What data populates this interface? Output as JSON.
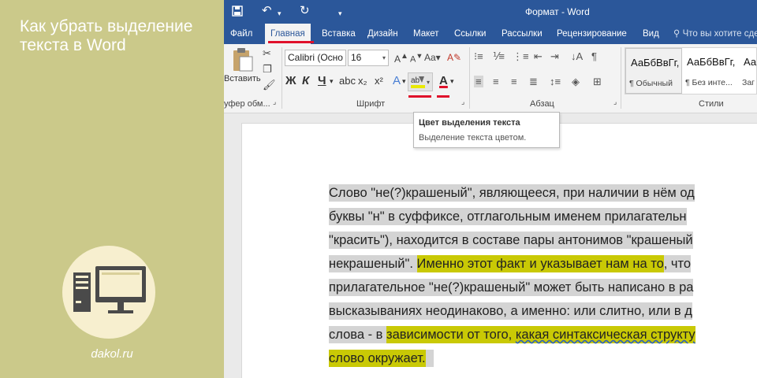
{
  "banner": {
    "title": "Как убрать выделение текста в Word",
    "site": "dakol.ru"
  },
  "titlebar": {
    "doc_title": "Формат - Word",
    "icons": [
      "save-icon",
      "undo-icon",
      "redo-icon",
      "customize-icon"
    ]
  },
  "tabs": [
    {
      "label": "Файл",
      "active": false
    },
    {
      "label": "Главная",
      "active": true
    },
    {
      "label": "Вставка",
      "active": false
    },
    {
      "label": "Дизайн",
      "active": false
    },
    {
      "label": "Макет",
      "active": false
    },
    {
      "label": "Ссылки",
      "active": false
    },
    {
      "label": "Рассылки",
      "active": false
    },
    {
      "label": "Рецензирование",
      "active": false
    },
    {
      "label": "Вид",
      "active": false
    }
  ],
  "tell_me": "Что вы хотите сде",
  "ribbon": {
    "clipboard": {
      "paste_label": "Вставить",
      "group_label": "уфер обм..."
    },
    "font": {
      "font_name": "Calibri (Осно",
      "font_size": "16",
      "bold": "Ж",
      "italic": "К",
      "underline": "Ч",
      "subscript": "x₂",
      "superscript": "x²",
      "group_label": "Шрифт"
    },
    "paragraph": {
      "group_label": "Абзац"
    },
    "styles": {
      "group_label": "Стили",
      "items": [
        {
          "sample": "АаБбВвГг,",
          "name": "¶ Обычный"
        },
        {
          "sample": "АаБбВвГг,",
          "name": "¶ Без инте..."
        },
        {
          "sample": "АаБбВ",
          "name": "Заг"
        }
      ]
    }
  },
  "tooltip": {
    "title": "Цвет выделения текста",
    "description": "Выделение текста цветом."
  },
  "document": {
    "lines": [
      [
        {
          "text": "Слово \"не(?)крашеный\", являющееся, при наличии в нём од",
          "hl": "gray"
        }
      ],
      [
        {
          "text": "буквы \"н\" в суффиксе, отглагольным именем прилагательн",
          "hl": "gray"
        }
      ],
      [
        {
          "text": "\"красить\"), находится в составе пары антонимов \"крашеный",
          "hl": "gray"
        }
      ],
      [
        {
          "text": "некрашеный\". ",
          "hl": "gray"
        },
        {
          "text": "Именно этот факт и указывает нам на то",
          "hl": "yel"
        },
        {
          "text": ", что",
          "hl": "gray"
        }
      ],
      [
        {
          "text": "прилагательное \"не(?)крашеный\" может быть написано в ра",
          "hl": "gray"
        }
      ],
      [
        {
          "text": "высказываниях неодинаково, а именно: или слитно, или в д",
          "hl": "gray"
        }
      ],
      [
        {
          "text": "слова - в ",
          "hl": "gray"
        },
        {
          "text": "зависимости от того, ",
          "hl": "yel"
        },
        {
          "text": "какая синтаксическая структу",
          "hl": "yel-squig"
        }
      ],
      [
        {
          "text": "слово окружает.",
          "hl": "yel"
        },
        {
          "text": " ",
          "hl": "gray"
        }
      ]
    ]
  },
  "colors": {
    "banner": "#cbc98a",
    "word_blue": "#2b579a",
    "highlight_yellow": "#c9c905",
    "selection_gray": "#d4d4d4",
    "accent_red": "#e0112b"
  }
}
